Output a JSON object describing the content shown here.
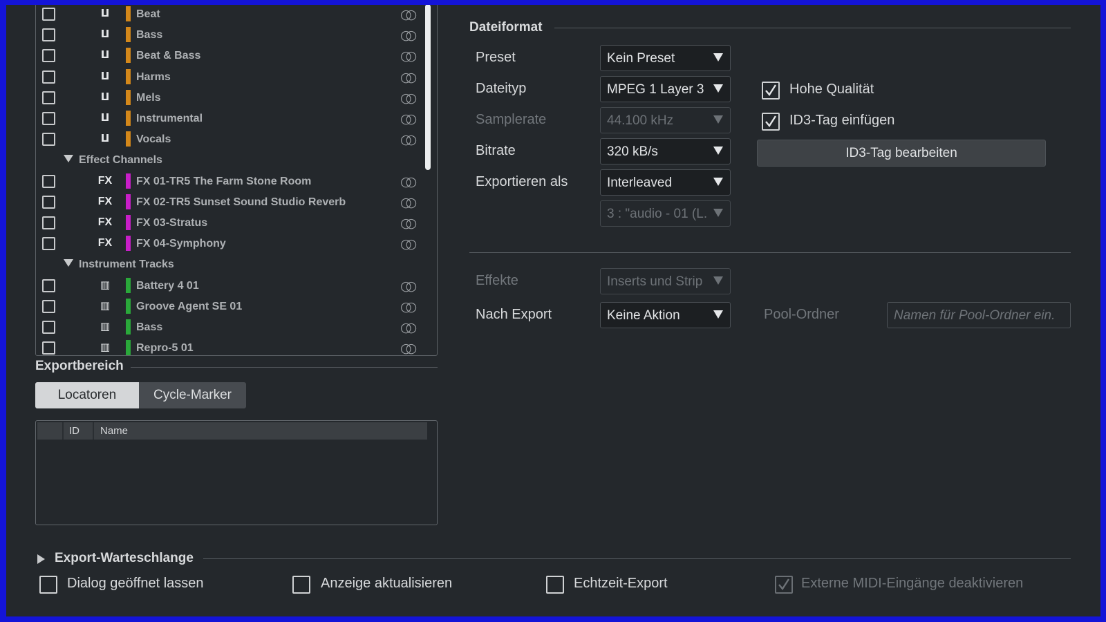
{
  "tree": {
    "rows": [
      {
        "kind": "track",
        "icon": "audio",
        "color": "#d4881a",
        "name": "Beat"
      },
      {
        "kind": "track",
        "icon": "audio",
        "color": "#d4881a",
        "name": "Bass"
      },
      {
        "kind": "track",
        "icon": "audio",
        "color": "#d4881a",
        "name": "Beat & Bass"
      },
      {
        "kind": "track",
        "icon": "audio",
        "color": "#d4881a",
        "name": "Harms"
      },
      {
        "kind": "track",
        "icon": "audio",
        "color": "#d4881a",
        "name": "Mels"
      },
      {
        "kind": "track",
        "icon": "audio",
        "color": "#d4881a",
        "name": "Instrumental"
      },
      {
        "kind": "track",
        "icon": "audio",
        "color": "#d4881a",
        "name": "Vocals"
      },
      {
        "kind": "group",
        "name": "Effect Channels"
      },
      {
        "kind": "track",
        "icon": "fx",
        "color": "#c81ec8",
        "name": "FX 01-TR5 The Farm Stone Room"
      },
      {
        "kind": "track",
        "icon": "fx",
        "color": "#c81ec8",
        "name": "FX 02-TR5 Sunset Sound Studio Reverb"
      },
      {
        "kind": "track",
        "icon": "fx",
        "color": "#c81ec8",
        "name": "FX 03-Stratus"
      },
      {
        "kind": "track",
        "icon": "fx",
        "color": "#c81ec8",
        "name": "FX 04-Symphony"
      },
      {
        "kind": "group",
        "name": "Instrument Tracks"
      },
      {
        "kind": "track",
        "icon": "instrument",
        "color": "#2aa83a",
        "name": "Battery 4 01"
      },
      {
        "kind": "track",
        "icon": "instrument",
        "color": "#2aa83a",
        "name": "Groove Agent SE 01"
      },
      {
        "kind": "track",
        "icon": "instrument",
        "color": "#2aa83a",
        "name": "Bass"
      },
      {
        "kind": "track",
        "icon": "instrument",
        "color": "#2aa83a",
        "name": "Repro-5 01"
      }
    ],
    "fx_icon_label": "FX",
    "audio_icon_glyph": "ⵡ",
    "instrument_icon_glyph": "▥",
    "link_icon_glyph": "○○"
  },
  "export_range": {
    "title": "Exportbereich",
    "tabs": [
      "Locatoren",
      "Cycle-Marker"
    ],
    "active_tab": "Locatoren",
    "table_headers": [
      "",
      "ID",
      "Name"
    ]
  },
  "file_format": {
    "title": "Dateiformat",
    "preset": {
      "label": "Preset",
      "value": "Kein Preset"
    },
    "filetype": {
      "label": "Dateityp",
      "value": "MPEG 1 Layer 3"
    },
    "samplerate": {
      "label": "Samplerate",
      "value": "44.100 kHz"
    },
    "bitrate": {
      "label": "Bitrate",
      "value": "320 kB/s"
    },
    "export_as": {
      "label": "Exportieren als",
      "value": "Interleaved"
    },
    "channel_select": {
      "value": "3 : \"audio - 01 (L."
    },
    "high_quality": {
      "label": "Hohe Qualität",
      "checked": true
    },
    "id3_insert": {
      "label": "ID3-Tag einfügen",
      "checked": true
    },
    "id3_edit_button": "ID3-Tag bearbeiten",
    "effects": {
      "label": "Effekte",
      "value": "Inserts und Strip"
    },
    "after_export": {
      "label": "Nach Export",
      "value": "Keine Aktion"
    },
    "pool_folder": {
      "label": "Pool-Ordner",
      "placeholder": "Namen für Pool-Ordner ein."
    }
  },
  "export_queue": {
    "title": "Export-Warteschlange"
  },
  "options": [
    {
      "label": "Dialog geöffnet lassen",
      "checked": false,
      "disabled": false
    },
    {
      "label": "Anzeige aktualisieren",
      "checked": false,
      "disabled": false
    },
    {
      "label": "Echtzeit-Export",
      "checked": false,
      "disabled": false
    },
    {
      "label": "Externe MIDI-Eingänge deaktivieren",
      "checked": true,
      "disabled": true
    }
  ]
}
